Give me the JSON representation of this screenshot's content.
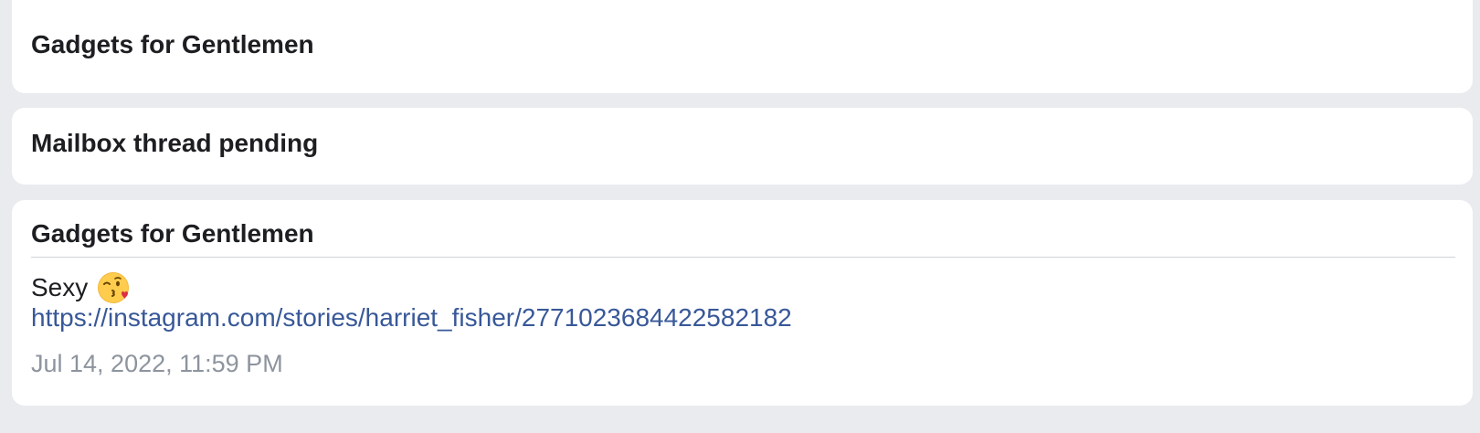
{
  "threads": [
    {
      "title": "Gadgets for Gentlemen"
    },
    {
      "title": "Mailbox thread pending"
    }
  ],
  "conversation": {
    "title": "Gadgets for Gentlemen",
    "message": {
      "text": "Sexy",
      "emoji": "face-throwing-a-kiss-icon",
      "link": "https://instagram.com/stories/harriet_fisher/2771023684422582182",
      "timestamp": "Jul 14, 2022, 11:59 PM"
    }
  },
  "colors": {
    "page_background": "#e9ebee",
    "card_background": "#ffffff",
    "title_text": "#1c1e21",
    "link_text": "#385898",
    "timestamp_text": "#8d949e",
    "divider": "#d0d3d8"
  }
}
